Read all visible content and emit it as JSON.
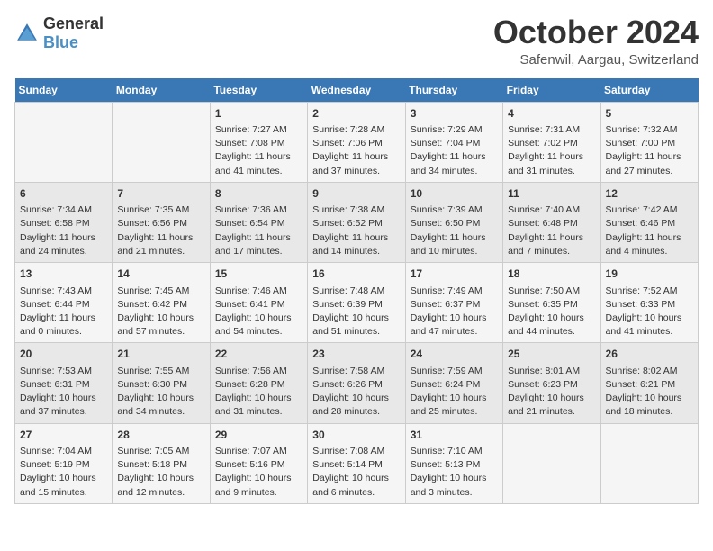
{
  "logo": {
    "general": "General",
    "blue": "Blue"
  },
  "title": "October 2024",
  "location": "Safenwil, Aargau, Switzerland",
  "days_header": [
    "Sunday",
    "Monday",
    "Tuesday",
    "Wednesday",
    "Thursday",
    "Friday",
    "Saturday"
  ],
  "weeks": [
    [
      {
        "day": "",
        "content": ""
      },
      {
        "day": "",
        "content": ""
      },
      {
        "day": "1",
        "content": "Sunrise: 7:27 AM\nSunset: 7:08 PM\nDaylight: 11 hours and 41 minutes."
      },
      {
        "day": "2",
        "content": "Sunrise: 7:28 AM\nSunset: 7:06 PM\nDaylight: 11 hours and 37 minutes."
      },
      {
        "day": "3",
        "content": "Sunrise: 7:29 AM\nSunset: 7:04 PM\nDaylight: 11 hours and 34 minutes."
      },
      {
        "day": "4",
        "content": "Sunrise: 7:31 AM\nSunset: 7:02 PM\nDaylight: 11 hours and 31 minutes."
      },
      {
        "day": "5",
        "content": "Sunrise: 7:32 AM\nSunset: 7:00 PM\nDaylight: 11 hours and 27 minutes."
      }
    ],
    [
      {
        "day": "6",
        "content": "Sunrise: 7:34 AM\nSunset: 6:58 PM\nDaylight: 11 hours and 24 minutes."
      },
      {
        "day": "7",
        "content": "Sunrise: 7:35 AM\nSunset: 6:56 PM\nDaylight: 11 hours and 21 minutes."
      },
      {
        "day": "8",
        "content": "Sunrise: 7:36 AM\nSunset: 6:54 PM\nDaylight: 11 hours and 17 minutes."
      },
      {
        "day": "9",
        "content": "Sunrise: 7:38 AM\nSunset: 6:52 PM\nDaylight: 11 hours and 14 minutes."
      },
      {
        "day": "10",
        "content": "Sunrise: 7:39 AM\nSunset: 6:50 PM\nDaylight: 11 hours and 10 minutes."
      },
      {
        "day": "11",
        "content": "Sunrise: 7:40 AM\nSunset: 6:48 PM\nDaylight: 11 hours and 7 minutes."
      },
      {
        "day": "12",
        "content": "Sunrise: 7:42 AM\nSunset: 6:46 PM\nDaylight: 11 hours and 4 minutes."
      }
    ],
    [
      {
        "day": "13",
        "content": "Sunrise: 7:43 AM\nSunset: 6:44 PM\nDaylight: 11 hours and 0 minutes."
      },
      {
        "day": "14",
        "content": "Sunrise: 7:45 AM\nSunset: 6:42 PM\nDaylight: 10 hours and 57 minutes."
      },
      {
        "day": "15",
        "content": "Sunrise: 7:46 AM\nSunset: 6:41 PM\nDaylight: 10 hours and 54 minutes."
      },
      {
        "day": "16",
        "content": "Sunrise: 7:48 AM\nSunset: 6:39 PM\nDaylight: 10 hours and 51 minutes."
      },
      {
        "day": "17",
        "content": "Sunrise: 7:49 AM\nSunset: 6:37 PM\nDaylight: 10 hours and 47 minutes."
      },
      {
        "day": "18",
        "content": "Sunrise: 7:50 AM\nSunset: 6:35 PM\nDaylight: 10 hours and 44 minutes."
      },
      {
        "day": "19",
        "content": "Sunrise: 7:52 AM\nSunset: 6:33 PM\nDaylight: 10 hours and 41 minutes."
      }
    ],
    [
      {
        "day": "20",
        "content": "Sunrise: 7:53 AM\nSunset: 6:31 PM\nDaylight: 10 hours and 37 minutes."
      },
      {
        "day": "21",
        "content": "Sunrise: 7:55 AM\nSunset: 6:30 PM\nDaylight: 10 hours and 34 minutes."
      },
      {
        "day": "22",
        "content": "Sunrise: 7:56 AM\nSunset: 6:28 PM\nDaylight: 10 hours and 31 minutes."
      },
      {
        "day": "23",
        "content": "Sunrise: 7:58 AM\nSunset: 6:26 PM\nDaylight: 10 hours and 28 minutes."
      },
      {
        "day": "24",
        "content": "Sunrise: 7:59 AM\nSunset: 6:24 PM\nDaylight: 10 hours and 25 minutes."
      },
      {
        "day": "25",
        "content": "Sunrise: 8:01 AM\nSunset: 6:23 PM\nDaylight: 10 hours and 21 minutes."
      },
      {
        "day": "26",
        "content": "Sunrise: 8:02 AM\nSunset: 6:21 PM\nDaylight: 10 hours and 18 minutes."
      }
    ],
    [
      {
        "day": "27",
        "content": "Sunrise: 7:04 AM\nSunset: 5:19 PM\nDaylight: 10 hours and 15 minutes."
      },
      {
        "day": "28",
        "content": "Sunrise: 7:05 AM\nSunset: 5:18 PM\nDaylight: 10 hours and 12 minutes."
      },
      {
        "day": "29",
        "content": "Sunrise: 7:07 AM\nSunset: 5:16 PM\nDaylight: 10 hours and 9 minutes."
      },
      {
        "day": "30",
        "content": "Sunrise: 7:08 AM\nSunset: 5:14 PM\nDaylight: 10 hours and 6 minutes."
      },
      {
        "day": "31",
        "content": "Sunrise: 7:10 AM\nSunset: 5:13 PM\nDaylight: 10 hours and 3 minutes."
      },
      {
        "day": "",
        "content": ""
      },
      {
        "day": "",
        "content": ""
      }
    ]
  ]
}
